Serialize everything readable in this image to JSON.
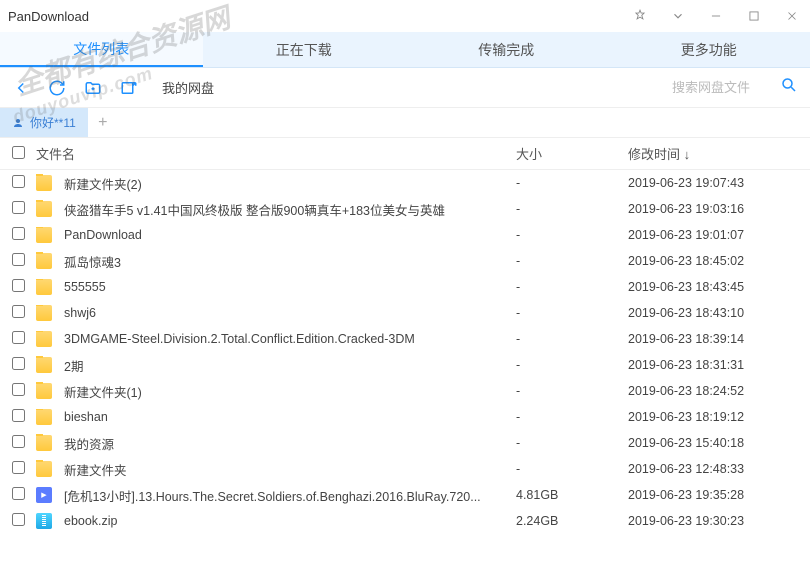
{
  "title": "PanDownload",
  "tabs": [
    {
      "label": "文件列表",
      "active": true
    },
    {
      "label": "正在下载",
      "active": false
    },
    {
      "label": "传输完成",
      "active": false
    },
    {
      "label": "更多功能",
      "active": false
    }
  ],
  "breadcrumb": "我的网盘",
  "search_placeholder": "搜索网盘文件",
  "account": "你好**11",
  "columns": {
    "name": "文件名",
    "size": "大小",
    "date": "修改时间 ↓"
  },
  "files": [
    {
      "type": "folder",
      "name": "新建文件夹(2)",
      "size": "-",
      "date": "2019-06-23 19:07:43"
    },
    {
      "type": "folder",
      "name": "侠盗猎车手5 v1.41中国风终极版 整合版900辆真车+183位美女与英雄",
      "size": "-",
      "date": "2019-06-23 19:03:16"
    },
    {
      "type": "folder",
      "name": "PanDownload",
      "size": "-",
      "date": "2019-06-23 19:01:07"
    },
    {
      "type": "folder",
      "name": "孤岛惊魂3",
      "size": "-",
      "date": "2019-06-23 18:45:02"
    },
    {
      "type": "folder",
      "name": "555555",
      "size": "-",
      "date": "2019-06-23 18:43:45"
    },
    {
      "type": "folder",
      "name": "shwj6",
      "size": "-",
      "date": "2019-06-23 18:43:10"
    },
    {
      "type": "folder",
      "name": "3DMGAME-Steel.Division.2.Total.Conflict.Edition.Cracked-3DM",
      "size": "-",
      "date": "2019-06-23 18:39:14"
    },
    {
      "type": "folder",
      "name": "2期",
      "size": "-",
      "date": "2019-06-23 18:31:31"
    },
    {
      "type": "folder",
      "name": "新建文件夹(1)",
      "size": "-",
      "date": "2019-06-23 18:24:52"
    },
    {
      "type": "folder",
      "name": "bieshan",
      "size": "-",
      "date": "2019-06-23 18:19:12"
    },
    {
      "type": "folder",
      "name": "我的资源",
      "size": "-",
      "date": "2019-06-23 15:40:18"
    },
    {
      "type": "folder",
      "name": "新建文件夹",
      "size": "-",
      "date": "2019-06-23 12:48:33"
    },
    {
      "type": "video",
      "name": "[危机13小时].13.Hours.The.Secret.Soldiers.of.Benghazi.2016.BluRay.720...",
      "size": "4.81GB",
      "date": "2019-06-23 19:35:28"
    },
    {
      "type": "zip",
      "name": "ebook.zip",
      "size": "2.24GB",
      "date": "2019-06-23 19:30:23"
    }
  ],
  "watermark1": "全都有综合资源网",
  "watermark2": "douyouvip.com"
}
